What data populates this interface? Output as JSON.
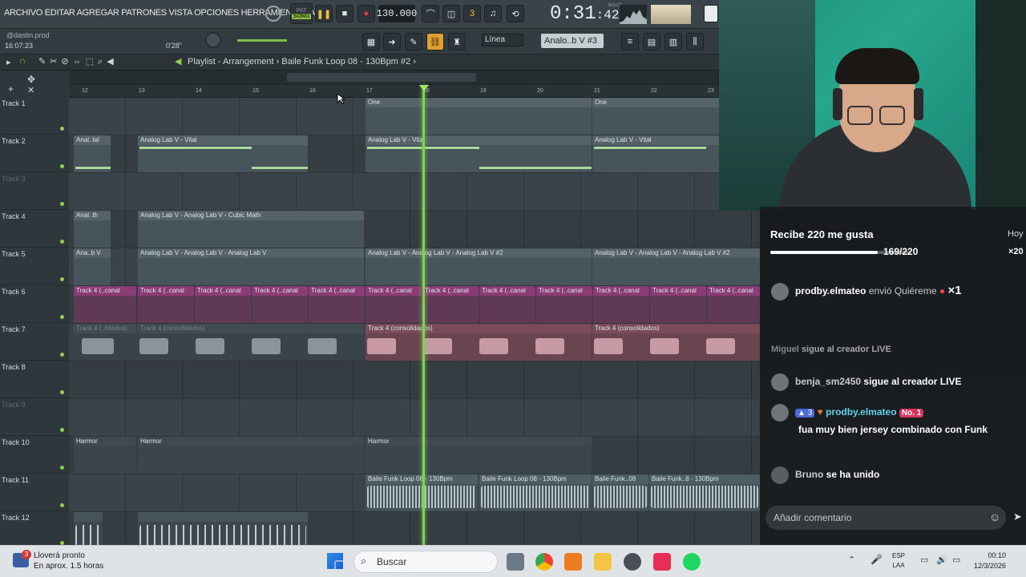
{
  "menubar": {
    "menu_text": "ARCHIVO EDITAR AGREGAR PATRONES VISTA OPCIONES HERRAMIENTAS AYU",
    "pat_label": "PAT",
    "song_label": "SONG",
    "tempo": "130.000",
    "time_main": "0:31",
    "time_frac": "42",
    "time_units": "M:S:CS",
    "cpu_label": "",
    "mem_label": ""
  },
  "hint_bar": {
    "user": "@dastin.prod",
    "time": "16:07:23",
    "position": "0'28\""
  },
  "toolbar": {
    "snap": "Línea",
    "pattern": "Analo..b V #3"
  },
  "playlist": {
    "caption": "Playlist - Arrangement  ›  Baile Funk Loop 08 - 130Bpm #2  ›",
    "bars": [
      "12",
      "13",
      "14",
      "15",
      "16",
      "17",
      "18",
      "19",
      "20",
      "21",
      "22",
      "23"
    ]
  },
  "tracks": [
    {
      "name": "Track 1"
    },
    {
      "name": "Track 2"
    },
    {
      "name": "Track 3"
    },
    {
      "name": "Track 4"
    },
    {
      "name": "Track 5"
    },
    {
      "name": "Track 6"
    },
    {
      "name": "Track 7"
    },
    {
      "name": "Track 8"
    },
    {
      "name": "Track 9"
    },
    {
      "name": "Track 10"
    },
    {
      "name": "Track 11"
    },
    {
      "name": "Track 12"
    }
  ],
  "clips": {
    "t1_one_a": "One",
    "t1_one_b": "One",
    "t2_a": "Anal..tal",
    "t2_b": "Analog Lab V - Vital",
    "t2_c": "Analog Lab V - Vital",
    "t2_d": "Analog Lab V - Vital",
    "t4_a": "Anal..th",
    "t4_b": "Analog Lab V - Analog Lab V - Cubic Math",
    "t4_ghost": "Analog Lab V - Analog Lab V - Cubic Math",
    "t5_a": "Ana..b V",
    "t5_b": "Analog Lab V - Analog Lab V - Analog Lab V",
    "t5_c": "Analog Lab V - Analog Lab V - Analog Lab V #2",
    "t5_d": "Analog Lab V - Analog Lab V - Analog Lab V #2",
    "t6_auto": "Track 4 (..canal",
    "t7_a": "Track 4 (..lidados)",
    "t7_b": "Track 4 (consolidados)",
    "t7_c": "Track 4 (consolidados)",
    "t7_d": "Track 4 (consolidados)",
    "t7_ghost": "Track 4 (consolidados) #2",
    "t10_a": "Harmor",
    "t10_b": "Harmor",
    "t10_c": "Harmor",
    "t11_a": "Baile Funk Loop 08 - 130Bpm",
    "t11_b": "Baile Funk Loop 08 - 130Bpm",
    "t11_c": "Baile Funk..08",
    "t11_d": "Baile Funk..8 - 130Bpm"
  },
  "live": {
    "goal_text": "Recibe 220 me gusta",
    "goal_count": "169/220",
    "goal_progress": 0.768,
    "today": "Hoy",
    "gift_mult": "×20",
    "gift_user": "prodby.elmateo",
    "gift_text": "envió Quiéreme",
    "gift_count": "×1",
    "follow_user_partial": "Miguel",
    "follow_text_partial": "sigue al creador LIVE",
    "follow_user": "benja_sm2450",
    "follow_text": "sigue al creador LIVE",
    "chat_level": "3",
    "chat_user": "prodby.elmateo",
    "chat_badge": "No. 1",
    "chat_msg": "fua muy bien jersey combinado con Funk",
    "join_user": "Bruno",
    "join_text": "se ha unido",
    "comment_placeholder": "Añadir comentario"
  },
  "taskbar": {
    "weather_title": "Lloverá pronto",
    "weather_sub": "En aprox. 1.5 horas",
    "weather_badge": "3",
    "search": "Buscar",
    "lang1": "ESP",
    "lang2": "LAA",
    "time": "00:10",
    "date": "12/3/2026"
  },
  "colors": {
    "accent_green": "#7fd34e",
    "clip_pattern": "#556268",
    "clip_audio": "#7a4c5a",
    "clip_auto": "#8b3c77"
  }
}
